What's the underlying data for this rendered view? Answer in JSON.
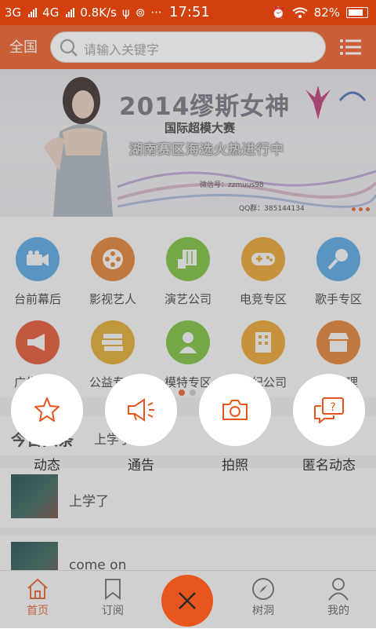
{
  "status_bar": {
    "net1": "3G",
    "net2": "4G",
    "speed": "0.8K/s",
    "overflow": "···",
    "time": "17:51",
    "battery": "82%"
  },
  "header": {
    "region": "全国",
    "search_placeholder": "请输入关键字",
    "icons": [
      "search-icon",
      "menu-icon"
    ]
  },
  "banner": {
    "title": "2014缪斯女神",
    "subtitle": "国际超模大赛",
    "subtitle2": "湖南赛区海选火热进行中",
    "contact": "微信号：zzmuus98",
    "qq": "QQ群：385144134"
  },
  "categories": [
    {
      "label": "台前幕后",
      "icon": "camera-icon",
      "color": "#4aa3e8"
    },
    {
      "label": "影视艺人",
      "icon": "film-reel-icon",
      "color": "#e8781f"
    },
    {
      "label": "演艺公司",
      "icon": "piano-icon",
      "color": "#74c02d"
    },
    {
      "label": "电竞专区",
      "icon": "gamepad-icon",
      "color": "#f0a020"
    },
    {
      "label": "歌手专区",
      "icon": "microphone-icon",
      "color": "#4aa3e8"
    },
    {
      "label": "广告专区",
      "icon": "megaphone-icon",
      "color": "#e8491f"
    },
    {
      "label": "公益专区",
      "icon": "books-icon",
      "color": "#e8a81f"
    },
    {
      "label": "模特专区",
      "icon": "model-icon",
      "color": "#74c02d"
    },
    {
      "label": "经纪公司",
      "icon": "building-icon",
      "color": "#f0a020"
    },
    {
      "label": "代理",
      "icon": "shop-icon",
      "color": "#e8781f"
    }
  ],
  "headlines": {
    "title": "今日头条",
    "item": "上学了"
  },
  "feed": [
    {
      "title": "上学了"
    },
    {
      "title": "come on"
    }
  ],
  "actions": [
    {
      "label": "动态",
      "icon": "star-icon"
    },
    {
      "label": "通告",
      "icon": "megaphone-icon"
    },
    {
      "label": "拍照",
      "icon": "camera-icon"
    },
    {
      "label": "匿名动态",
      "icon": "chat-question-icon"
    }
  ],
  "tabs": [
    {
      "label": "首页",
      "icon": "home-icon",
      "active": true
    },
    {
      "label": "订阅",
      "icon": "bookmark-icon",
      "active": false
    },
    {
      "label": "树洞",
      "icon": "compass-icon",
      "active": false
    },
    {
      "label": "我的",
      "icon": "person-icon",
      "active": false
    }
  ],
  "accent_color": "#e8561f"
}
